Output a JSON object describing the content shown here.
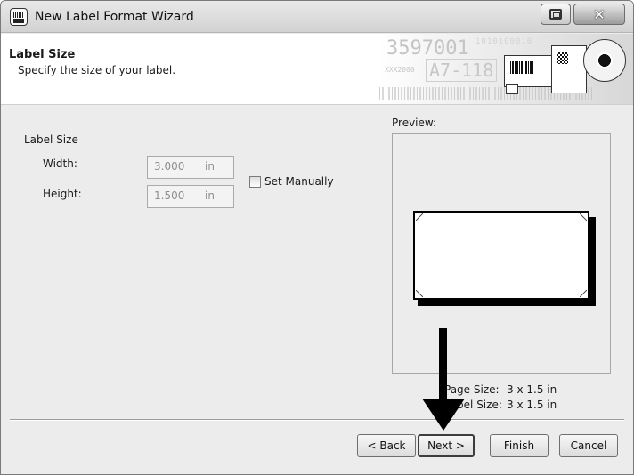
{
  "window": {
    "title": "New Label Format Wizard",
    "close_glyph": "✕"
  },
  "header": {
    "title": "Label Size",
    "subtitle": "Specify the size of your label.",
    "banner_text": {
      "line1": "3597001",
      "line2": "XXX2000",
      "line3": "A7-118",
      "line4": "1010100010"
    }
  },
  "label_size": {
    "legend": "Label Size",
    "width_label": "Width:",
    "width_value": "3.000",
    "width_unit": "in",
    "height_label": "Height:",
    "height_value": "1.500",
    "height_unit": "in",
    "set_manually_label": "Set Manually",
    "set_manually_checked": false
  },
  "preview": {
    "label": "Preview:",
    "page_size_label": "Page Size:",
    "page_size_value": "3 x 1.5 in",
    "label_size_label": "Label Size:",
    "label_size_value": "3 x 1.5 in"
  },
  "buttons": {
    "back": "< Back",
    "next": "Next >",
    "finish": "Finish",
    "cancel": "Cancel"
  },
  "colors": {
    "window_bg": "#ececec",
    "header_bg": "#ffffff",
    "annotation_arrow": "#000000"
  }
}
